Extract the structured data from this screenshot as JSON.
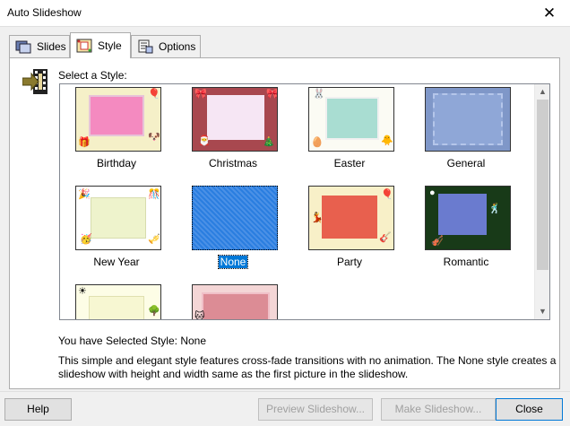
{
  "window": {
    "title": "Auto Slideshow",
    "close_glyph": "✕"
  },
  "tabs": [
    {
      "label": "Slides",
      "icon": "slides-icon"
    },
    {
      "label": "Style",
      "icon": "style-icon",
      "active": true
    },
    {
      "label": "Options",
      "icon": "options-icon"
    }
  ],
  "style_panel": {
    "select_label": "Select a Style:",
    "styles": [
      {
        "label": "Birthday",
        "bg": "#f5f0c8",
        "inner": "#f48ac0"
      },
      {
        "label": "Christmas",
        "bg": "#a8484f",
        "inner": "#f6e6f4"
      },
      {
        "label": "Easter",
        "bg": "#fbfbf4",
        "inner": "#a9ddd2"
      },
      {
        "label": "General",
        "bg": "#7f97c8",
        "inner": "#8fa7d7"
      },
      {
        "label": "New Year",
        "bg": "#ffffff",
        "inner": "#eef3cc"
      },
      {
        "label": "None",
        "bg": "#1e74d8",
        "inner": "#3d86e0",
        "selected": true
      },
      {
        "label": "Party",
        "bg": "#f8f0c8",
        "inner": "#e8604e"
      },
      {
        "label": "Romantic",
        "bg": "#183a18",
        "inner": "#6a7bcf"
      },
      {
        "label": "",
        "bg": "#fdfde6",
        "inner": "#f7f7d2"
      },
      {
        "label": "",
        "bg": "#f4d6d6",
        "inner": "#dc8c95"
      }
    ]
  },
  "selected_style_text": "You have Selected Style: None",
  "description": "This simple and elegant style features cross-fade transitions with no animation. The None style creates a slideshow with height and width same as the first picture in the slideshow.",
  "buttons": {
    "help": "Help",
    "preview": "Preview Slideshow...",
    "make": "Make Slideshow...",
    "close": "Close"
  },
  "colors": {
    "selection": "#0078d7",
    "disabled_text": "#a0a0a0"
  }
}
